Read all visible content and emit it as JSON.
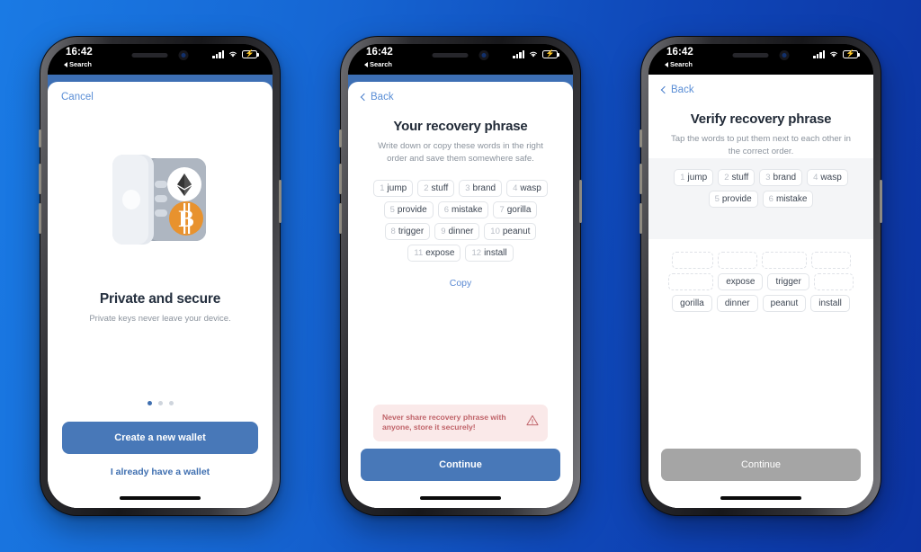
{
  "theme": {
    "bg_gradient_from": "#1a7ae4",
    "bg_gradient_to": "#0c33a2",
    "primary_button": "#4878b8",
    "disabled_button": "#a5a5a5",
    "link_blue": "#5b8ad3",
    "warning_bg": "#fae9e9",
    "warning_text": "#c0646a",
    "bitcoin_orange": "#e8922e"
  },
  "status_bar": {
    "time": "16:42",
    "back_label": "Search",
    "signal_icon": "cellular-signal-icon",
    "wifi_icon": "wifi-icon",
    "battery_icon": "battery-charging-icon"
  },
  "phones": [
    {
      "id": "phone-1",
      "nav": {
        "left_label": "Cancel",
        "type": "cancel"
      },
      "hero": {
        "illustration": "vault-safe-icon",
        "coins": [
          "ethereum-icon",
          "bitcoin-icon"
        ],
        "title": "Private and secure",
        "subtitle": "Private keys never leave your device."
      },
      "pager": {
        "total": 3,
        "active": 1
      },
      "primary_button": "Create a new wallet",
      "text_button": "I already have a wallet"
    },
    {
      "id": "phone-2",
      "nav": {
        "left_label": "Back",
        "type": "back"
      },
      "title": "Your recovery phrase",
      "subtitle": "Write down or copy these words in the right order and save them somewhere safe.",
      "phrase": [
        {
          "num": "1",
          "word": "jump"
        },
        {
          "num": "2",
          "word": "stuff"
        },
        {
          "num": "3",
          "word": "brand"
        },
        {
          "num": "4",
          "word": "wasp"
        },
        {
          "num": "5",
          "word": "provide"
        },
        {
          "num": "6",
          "word": "mistake"
        },
        {
          "num": "7",
          "word": "gorilla"
        },
        {
          "num": "8",
          "word": "trigger"
        },
        {
          "num": "9",
          "word": "dinner"
        },
        {
          "num": "10",
          "word": "peanut"
        },
        {
          "num": "11",
          "word": "expose"
        },
        {
          "num": "12",
          "word": "install"
        }
      ],
      "copy_link": "Copy",
      "warning": {
        "text": "Never share recovery phrase with anyone, store it securely!",
        "icon": "warning-triangle-icon"
      },
      "primary_button": "Continue"
    },
    {
      "id": "phone-3",
      "nav": {
        "left_label": "Back",
        "type": "back"
      },
      "title": "Verify recovery phrase",
      "subtitle": "Tap the words to put them next to each other in the correct order.",
      "selected": [
        {
          "num": "1",
          "word": "jump"
        },
        {
          "num": "2",
          "word": "stuff"
        },
        {
          "num": "3",
          "word": "brand"
        },
        {
          "num": "4",
          "word": "wasp"
        },
        {
          "num": "5",
          "word": "provide"
        },
        {
          "num": "6",
          "word": "mistake"
        }
      ],
      "bank_rows": [
        [
          {
            "type": "slot"
          },
          {
            "type": "slot"
          },
          {
            "type": "slot"
          },
          {
            "type": "slot"
          }
        ],
        [
          {
            "type": "slot"
          },
          {
            "type": "word",
            "word": "expose"
          },
          {
            "type": "word",
            "word": "trigger"
          },
          {
            "type": "slot"
          }
        ],
        [
          {
            "type": "word",
            "word": "gorilla"
          },
          {
            "type": "word",
            "word": "dinner"
          },
          {
            "type": "word",
            "word": "peanut"
          },
          {
            "type": "word",
            "word": "install"
          }
        ]
      ],
      "primary_button": "Continue",
      "primary_button_disabled": true
    }
  ]
}
